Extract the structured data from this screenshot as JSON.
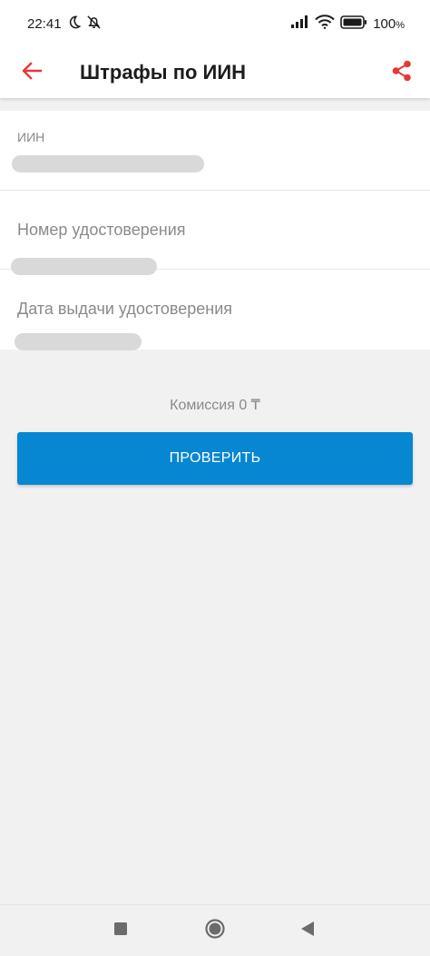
{
  "status_bar": {
    "time": "22:41",
    "battery": "100",
    "icons": [
      "moon-icon",
      "alarm-off-icon",
      "signal-icon",
      "wifi-icon",
      "battery-icon"
    ]
  },
  "app_bar": {
    "title": "Штрафы по ИИН",
    "icons": [
      "arrow-left-icon",
      "share-icon"
    ],
    "accent_color": "#e53935"
  },
  "form": {
    "fields": [
      {
        "label": "ИИН",
        "value": ""
      },
      {
        "label": "Номер удостоверения",
        "value": ""
      },
      {
        "label": "Дата выдачи удостоверения",
        "value": ""
      }
    ]
  },
  "commission_text": "Комиссия 0 ₸",
  "check_button_label": "ПРОВЕРИТЬ",
  "colors": {
    "button": "#0786d1",
    "background": "#f1f1f1"
  },
  "nav_bar": {
    "icons": [
      "recent-apps-icon",
      "home-icon",
      "back-icon"
    ]
  }
}
